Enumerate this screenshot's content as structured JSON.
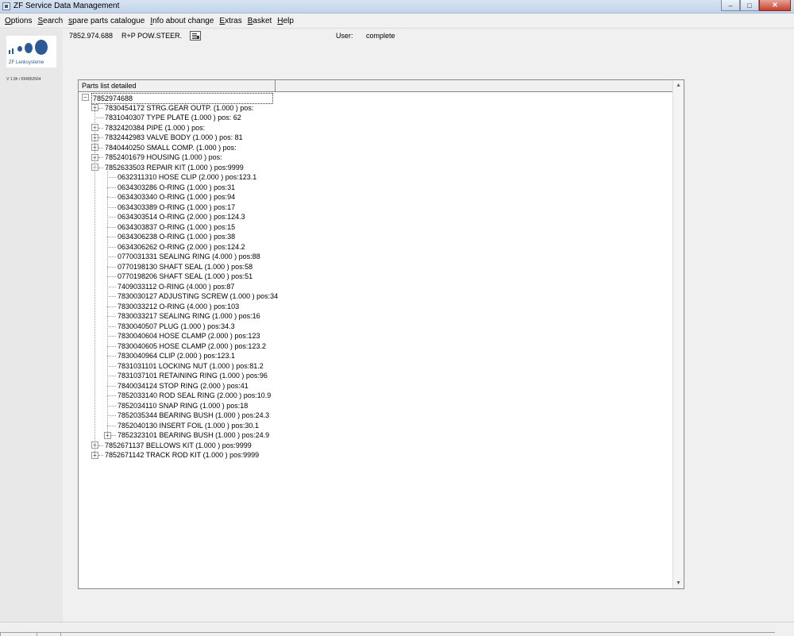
{
  "window": {
    "title": "ZF Service Data Management"
  },
  "menu": [
    {
      "underline": "O",
      "rest": "ptions"
    },
    {
      "underline": "S",
      "rest": "earch"
    },
    {
      "underline": "s",
      "rest": "pare parts catalogue"
    },
    {
      "underline": "I",
      "rest": "nfo about change"
    },
    {
      "underline": "E",
      "rest": "xtras"
    },
    {
      "underline": "B",
      "rest": "asket"
    },
    {
      "underline": "H",
      "rest": "elp"
    }
  ],
  "sidebar": {
    "brand": "ZF Lenksysteme",
    "version": "V 1.0h / 694852664"
  },
  "header": {
    "part_number": "7852.974.688",
    "description": "R+P POW.STEER.",
    "user_label": "User:",
    "user_value": "complete"
  },
  "tree": {
    "column_header": "Parts list detailed",
    "root": "7852974688",
    "level1": [
      {
        "text": "7830454172  STRG.GEAR OUTP.  (1.000 )  pos:",
        "expandable": true
      },
      {
        "text": "7831040307  TYPE PLATE  (1.000 )  pos:  62",
        "expandable": false
      },
      {
        "text": "7832420384  PIPE  (1.000 )  pos:",
        "expandable": true
      },
      {
        "text": "7832442983  VALVE BODY  (1.000 )  pos:  81",
        "expandable": true
      },
      {
        "text": "7840440250  SMALL COMP.  (1.000 )  pos:",
        "expandable": true
      },
      {
        "text": "7852401679  HOUSING  (1.000 )  pos:",
        "expandable": true
      },
      {
        "text": "7852633503  REPAIR KIT  (1.000 )  pos:9999",
        "expandable": true,
        "expanded": true
      },
      {
        "text": "7852671137  BELLOWS KIT  (1.000 )  pos:9999",
        "expandable": true
      },
      {
        "text": "7852671142  TRACK ROD KIT  (1.000 )  pos:9999",
        "expandable": true
      }
    ],
    "repair_kit_children": [
      {
        "text": "0632311310  HOSE CLIP  (2.000 )  pos:123.1"
      },
      {
        "text": "0634303286  O-RING  (1.000 )  pos:31"
      },
      {
        "text": "0634303340  O-RING  (1.000 )  pos:94"
      },
      {
        "text": "0634303389  O-RING  (1.000 )  pos:17"
      },
      {
        "text": "0634303514  O-RING  (2.000 )  pos:124.3"
      },
      {
        "text": "0634303837  O-RING  (1.000 )  pos:15"
      },
      {
        "text": "0634306238  O-RING  (1.000 )  pos:38"
      },
      {
        "text": "0634306262  O-RING  (2.000 )  pos:124.2"
      },
      {
        "text": "0770031331  SEALING RING  (4.000 )  pos:88"
      },
      {
        "text": "0770198130  SHAFT SEAL  (1.000 )  pos:58"
      },
      {
        "text": "0770198206  SHAFT SEAL  (1.000 )  pos:51"
      },
      {
        "text": "7409033112  O-RING  (4.000 )  pos:87"
      },
      {
        "text": "7830030127  ADJUSTING SCREW  (1.000 )  pos:34"
      },
      {
        "text": "7830033212  O-RING  (4.000 )  pos:103"
      },
      {
        "text": "7830033217  SEALING RING  (1.000 )  pos:16"
      },
      {
        "text": "7830040507  PLUG  (1.000 )  pos:34.3"
      },
      {
        "text": "7830040604  HOSE CLAMP  (2.000 )  pos:123"
      },
      {
        "text": "7830040605  HOSE CLAMP  (2.000 )  pos:123.2"
      },
      {
        "text": "7830040964  CLIP  (2.000 )  pos:123.1"
      },
      {
        "text": "7831031101  LOCKING NUT  (1.000 )  pos:81.2"
      },
      {
        "text": "7831037101  RETAINING RING  (1.000 )  pos:96"
      },
      {
        "text": "7840034124  STOP RING  (2.000 )  pos:41"
      },
      {
        "text": "7852033140  ROD SEAL RING  (2.000 )  pos:10.9"
      },
      {
        "text": "7852034110  SNAP RING  (1.000 )  pos:18"
      },
      {
        "text": "7852035344  BEARING BUSH  (1.000 )  pos:24.3"
      },
      {
        "text": "7852040130  INSERT FOIL  (1.000 )  pos:30.1"
      },
      {
        "text": "7852323101  BEARING BUSH  (1.000 )  pos:24.9",
        "expandable": true
      }
    ]
  },
  "icons": {
    "minimize": "minimize-icon",
    "maximize": "maximize-icon",
    "close": "close-icon",
    "scroll_up": "scroll-up-icon",
    "scroll_down": "scroll-down-icon"
  },
  "colors": {
    "brand_blue": "#2b5a97",
    "titlebar": "#c2d4ea"
  }
}
